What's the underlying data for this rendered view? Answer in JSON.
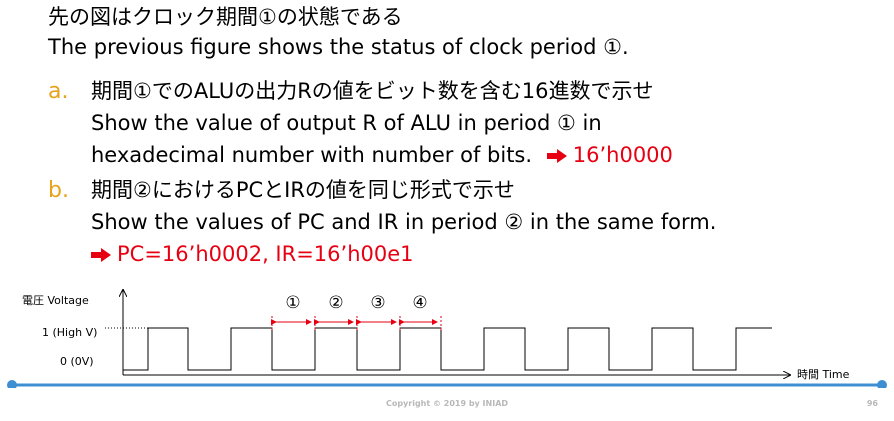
{
  "intro": {
    "jp": "先の図はクロック期間①の状態である",
    "en": "The previous figure shows the status of clock period ①."
  },
  "item_a": {
    "marker": "a.",
    "jp": "期間①でのALUの出力Rの値をビット数を含む16進数で示せ",
    "en_line1": "Show the value of output R of ALU in period ① in",
    "en_line2": "hexadecimal number with number of bits.",
    "answer": "16’h0000"
  },
  "item_b": {
    "marker": "b.",
    "jp": "期間②におけるPCとIRの値を同じ形式で示せ",
    "en": "Show the values of PC and IR in period ② in the same form.",
    "answer": "PC=16’h0002, IR=16’h00e1"
  },
  "diagram": {
    "y_axis_label": "電圧 Voltage",
    "level_high": "1 (High V)",
    "level_low": "0 (0V)",
    "x_axis_label": "時間 Time",
    "period_labels": [
      "①",
      "②",
      "③",
      "④"
    ]
  },
  "footer": {
    "copyright": "Copyright © 2019 by INIAD",
    "page_number": "96"
  },
  "colors": {
    "accent": "#e8a21b",
    "answer_red": "#e60012",
    "divider_blue": "#3d8fd1"
  }
}
